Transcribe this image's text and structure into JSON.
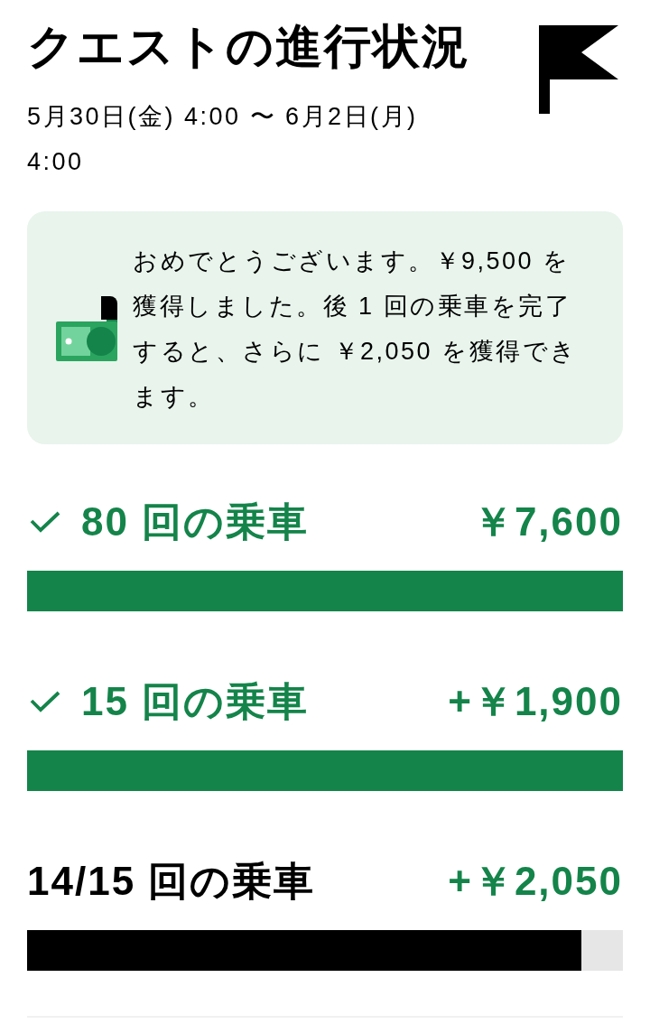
{
  "header": {
    "title": "クエストの進行状況",
    "period": "5月30日(金) 4:00 〜 6月2日(月) 4:00"
  },
  "notice": {
    "message": "おめでとうございます。￥9,500 を獲得しました。後 1 回の乗車を完了すると、さらに ￥2,050 を獲得できます。"
  },
  "milestones": [
    {
      "label": "80 回の乗車",
      "reward": "￥7,600",
      "completed": true,
      "level": 1
    },
    {
      "label": "15 回の乗車",
      "reward": "+￥1,900",
      "completed": true,
      "level": 1
    },
    {
      "label": "14/15 回の乗車",
      "reward": "+￥2,050",
      "completed": false,
      "level": 0.93
    }
  ]
}
